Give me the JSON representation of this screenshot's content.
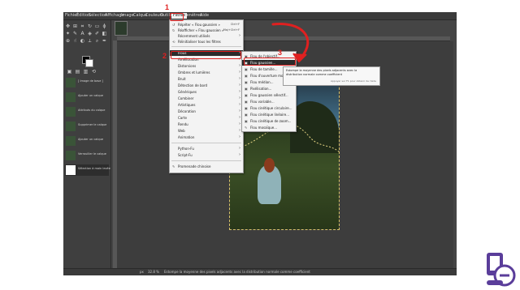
{
  "menubar": {
    "items": [
      "Fichier",
      "Édition",
      "Sélection",
      "Affichage",
      "Image",
      "Calque",
      "Couleurs",
      "Outils",
      "Filtres",
      "Fenêtres",
      "Aide"
    ],
    "active": "Filtres"
  },
  "history": {
    "items": [
      "[ Image de base ]",
      "Ajouter un calque",
      "Attributs du calque",
      "Supprimer le calque",
      "Ajouter un calque",
      "Verrouiller le calque",
      "Sélection à main levée"
    ]
  },
  "filters_menu": {
    "top": [
      {
        "icon": "repeat-icon",
        "label": "Répéter « Flou gaussien »",
        "shortcut": "Ctrl+F"
      },
      {
        "icon": "reshow-icon",
        "label": "Réafficher « Flou gaussien »",
        "shortcut": "Maj+Ctrl+F"
      },
      {
        "icon": "",
        "label": "Récemment utilisés",
        "submenu": true
      },
      {
        "icon": "reset-icon",
        "label": "Réinitialiser tous les filtres"
      }
    ],
    "categories": [
      {
        "label": "Flous",
        "submenu": true
      },
      {
        "label": "Amélioration",
        "submenu": true
      },
      {
        "label": "Distorsions",
        "submenu": true
      },
      {
        "label": "Ombres et lumières",
        "submenu": true
      },
      {
        "label": "Bruit",
        "submenu": true
      },
      {
        "label": "Détection de bord",
        "submenu": true
      },
      {
        "label": "Génériques",
        "submenu": true
      },
      {
        "label": "Combiner",
        "submenu": true
      },
      {
        "label": "Artistiques",
        "submenu": true
      },
      {
        "label": "Décoration",
        "submenu": true
      },
      {
        "label": "Carte",
        "submenu": true
      },
      {
        "label": "Rendu",
        "submenu": true
      },
      {
        "label": "Web",
        "submenu": true
      },
      {
        "label": "Animation",
        "submenu": true
      }
    ],
    "bottom": [
      {
        "label": "Python-Fu",
        "submenu": true
      },
      {
        "label": "Script-Fu",
        "submenu": true
      }
    ],
    "last": {
      "icon": "script-icon",
      "label": "Promenade chinoise"
    }
  },
  "blur_submenu": {
    "items": [
      "Flou de l'objectif...",
      "Flou gaussien...",
      "Flou de tamille...",
      "Flou d'ouverture moyenne...",
      "Flou médian...",
      "Pixélisation...",
      "Flou gaussien sélectif...",
      "Flou variable...",
      "Flou cinétique circulaire...",
      "Flou cinétique linéaire...",
      "Flou cinétique de zoom...",
      "Flou mosaïque..."
    ],
    "highlighted_index": 1
  },
  "tooltip": {
    "line1": "Estompe la moyenne des pixels adjacents avec la",
    "line2": "distribution normale comme coefficient",
    "hint": "Appuyer sur F1 pour obtenir de l'aide"
  },
  "status": {
    "unit": "px",
    "zoom": "32.8 %",
    "message": "Estompe la moyenne des pixels adjacents avec la distribution normale comme coefficient"
  },
  "steps": [
    "1",
    "2",
    "3"
  ],
  "colors": {
    "annotation": "#e02020",
    "menu_highlight": "#2b2b2b",
    "app_bg": "#454545"
  }
}
